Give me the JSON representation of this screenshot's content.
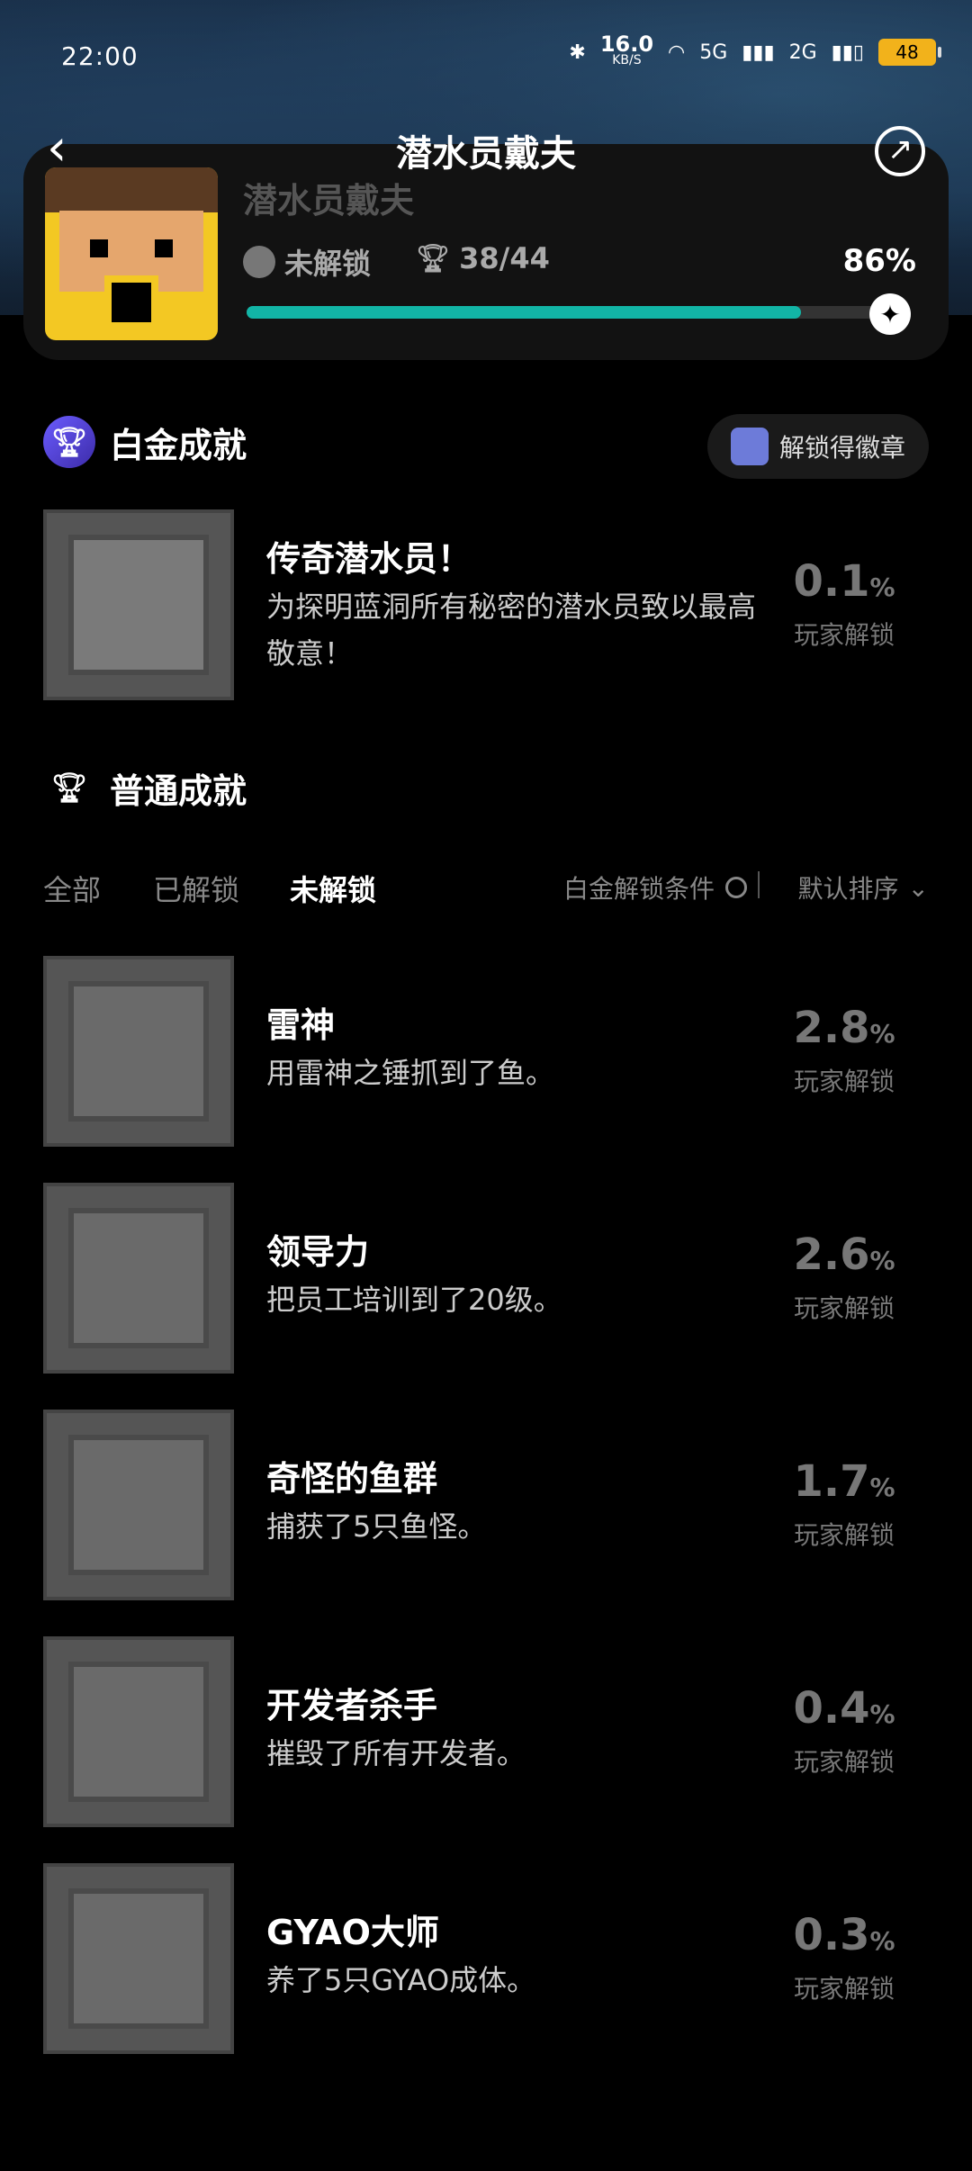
{
  "status_bar": {
    "time": "22:00",
    "net_speed": "16.0",
    "net_unit": "KB/S",
    "sig1": "5G",
    "sig2": "2G",
    "battery": "48"
  },
  "header": {
    "title": "潜水员戴夫"
  },
  "game": {
    "name": "潜水员戴夫",
    "status": "未解锁",
    "progress": "38/44",
    "percent_label": "86%",
    "percent_value": 0.86
  },
  "platinum": {
    "section_title": "白金成就",
    "badge_button": "解锁得徽章",
    "item": {
      "name": "传奇潜水员！",
      "desc": "为探明蓝洞所有秘密的潜水员致以最高敬意！",
      "percent": "0.1",
      "unit": "%",
      "sub": "玩家解锁"
    }
  },
  "normal": {
    "section_title": "普通成就",
    "filters": [
      "全部",
      "已解锁",
      "未解锁"
    ],
    "active_filter": "未解锁",
    "condition_label": "白金解锁条件",
    "sort_label": "默认排序",
    "items": [
      {
        "name": "雷神",
        "desc": "用雷神之锤抓到了鱼。",
        "percent": "2.8",
        "unit": "%",
        "sub": "玩家解锁"
      },
      {
        "name": "领导力",
        "desc": "把员工培训到了20级。",
        "percent": "2.6",
        "unit": "%",
        "sub": "玩家解锁"
      },
      {
        "name": "奇怪的鱼群",
        "desc": "捕获了5只鱼怪。",
        "percent": "1.7",
        "unit": "%",
        "sub": "玩家解锁"
      },
      {
        "name": "开发者杀手",
        "desc": "摧毁了所有开发者。",
        "percent": "0.4",
        "unit": "%",
        "sub": "玩家解锁"
      },
      {
        "name": "GYAO大师",
        "desc": "养了5只GYAO成体。",
        "percent": "0.3",
        "unit": "%",
        "sub": "玩家解锁"
      }
    ]
  },
  "icons": [
    "back-icon",
    "share-icon",
    "trophy-icon",
    "cup-icon",
    "platinum-trophy-icon",
    "badge-icon",
    "chevron-down-icon",
    "star-knob-icon"
  ]
}
